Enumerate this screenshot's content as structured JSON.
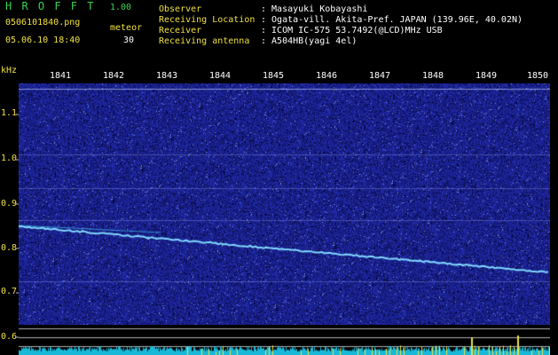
{
  "app": {
    "title": "H R O F F T",
    "version": "1.00",
    "filename": "0506101840.png",
    "datetime": "05.06.10 18:40",
    "counter_label": "meteor",
    "counter_value": "30"
  },
  "info": {
    "labels": [
      "Observer",
      "Receiving Location",
      "Receiver",
      "Receiving antenna"
    ],
    "values": [
      ": Masayuki Kobayashi",
      ": Ogata-vill. Akita-Pref. JAPAN (139.96E, 40.02N)",
      ": ICOM IC-575 53.7492(@LCD)MHz USB",
      ": A504HB(yagi 4el)"
    ]
  },
  "axis": {
    "unit": "kHz",
    "y_ticks": [
      "1.1",
      "1.0",
      "0.9",
      "0.8",
      "0.7",
      "0.6"
    ],
    "x_ticks": [
      "1841",
      "1842",
      "1843",
      "1844",
      "1845",
      "1846",
      "1847",
      "1848",
      "1849",
      "1850"
    ]
  },
  "colors": {
    "background": "#000000",
    "label_yellow": "#f0e040",
    "title_green": "#39d353",
    "noise_blue": "#1c2a8c",
    "trace": "#7fd8ff",
    "gridline": "#b0b0b0",
    "cyan_bar": "#18b8d8"
  }
}
